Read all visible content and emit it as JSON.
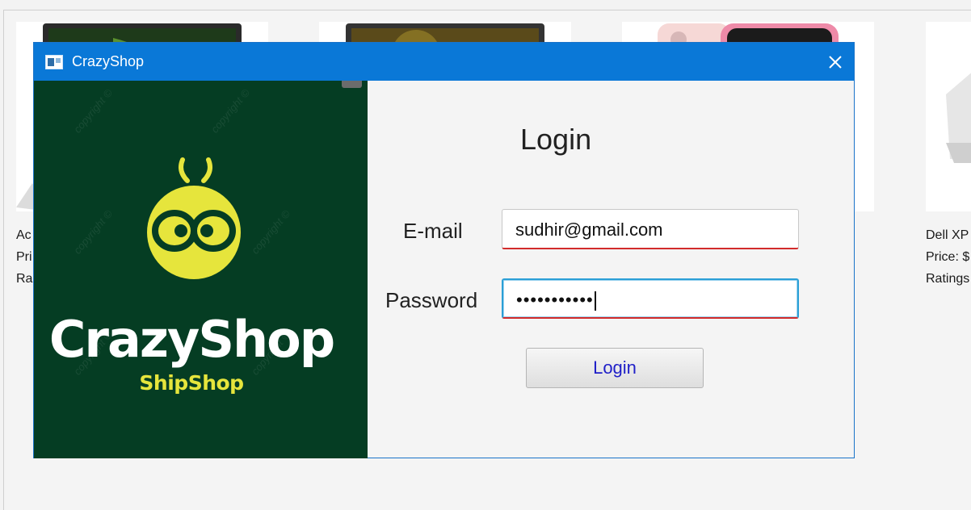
{
  "background": {
    "cards": [
      {
        "name": "Ac",
        "price": "Pri",
        "rating": "Ra"
      },
      {
        "name": "",
        "price": "",
        "rating": ""
      },
      {
        "name": "",
        "price": "",
        "rating": ""
      },
      {
        "name": "Dell XP",
        "price": "Price: $",
        "rating": "Ratings"
      }
    ]
  },
  "dialog": {
    "title": "CrazyShop",
    "brand": {
      "name": "CrazyShop",
      "tagline": "ShipShop",
      "watermark": "copyright ©"
    },
    "form": {
      "heading": "Login",
      "email_label": "E-mail",
      "email_value": "sudhir@gmail.com",
      "password_label": "Password",
      "password_masked": "•••••••••••",
      "submit_label": "Login"
    }
  }
}
